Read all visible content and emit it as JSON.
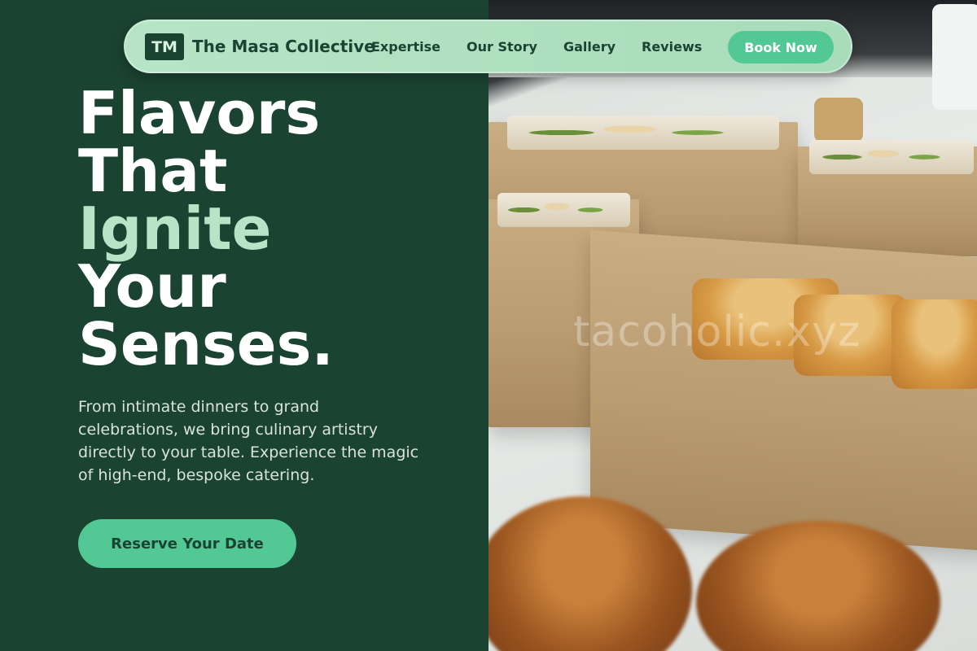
{
  "nav": {
    "logo_initials": "TM",
    "brand": "The Masa Collective",
    "links": [
      "Expertise",
      "Our Story",
      "Gallery",
      "Reviews"
    ],
    "cta": "Book Now"
  },
  "hero": {
    "line1": "Flavors",
    "line2": "That",
    "line3": "Ignite",
    "line4": "Your",
    "line5": "Senses.",
    "description": "From intimate dinners to grand celebrations, we bring culinary artistry directly to your table. Experience the magic of high-end, bespoke catering.",
    "cta": "Reserve Your Date"
  },
  "image": {
    "watermark": "tacoholic.xyz"
  },
  "colors": {
    "background": "#1b4332",
    "nav_bg": "#b7e4c7",
    "accent": "#52c994",
    "headline_accent": "#b7e4c7"
  }
}
